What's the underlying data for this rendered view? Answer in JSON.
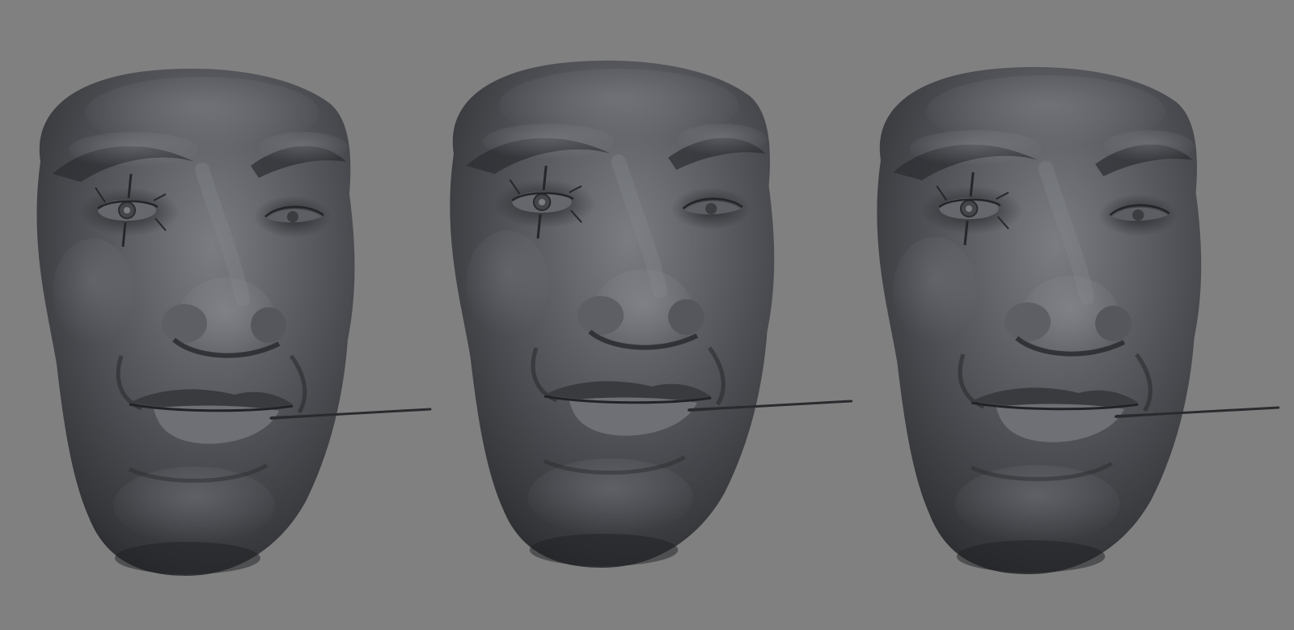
{
  "scene": {
    "background_color": "#808080",
    "material_color": "#4a4b4f",
    "highlight_color": "#8a8c92",
    "shadow_color": "#1e1f22",
    "models": [
      {
        "name": "face-sculpt-left-view"
      },
      {
        "name": "face-sculpt-center-view"
      },
      {
        "name": "face-sculpt-right-view"
      }
    ]
  }
}
